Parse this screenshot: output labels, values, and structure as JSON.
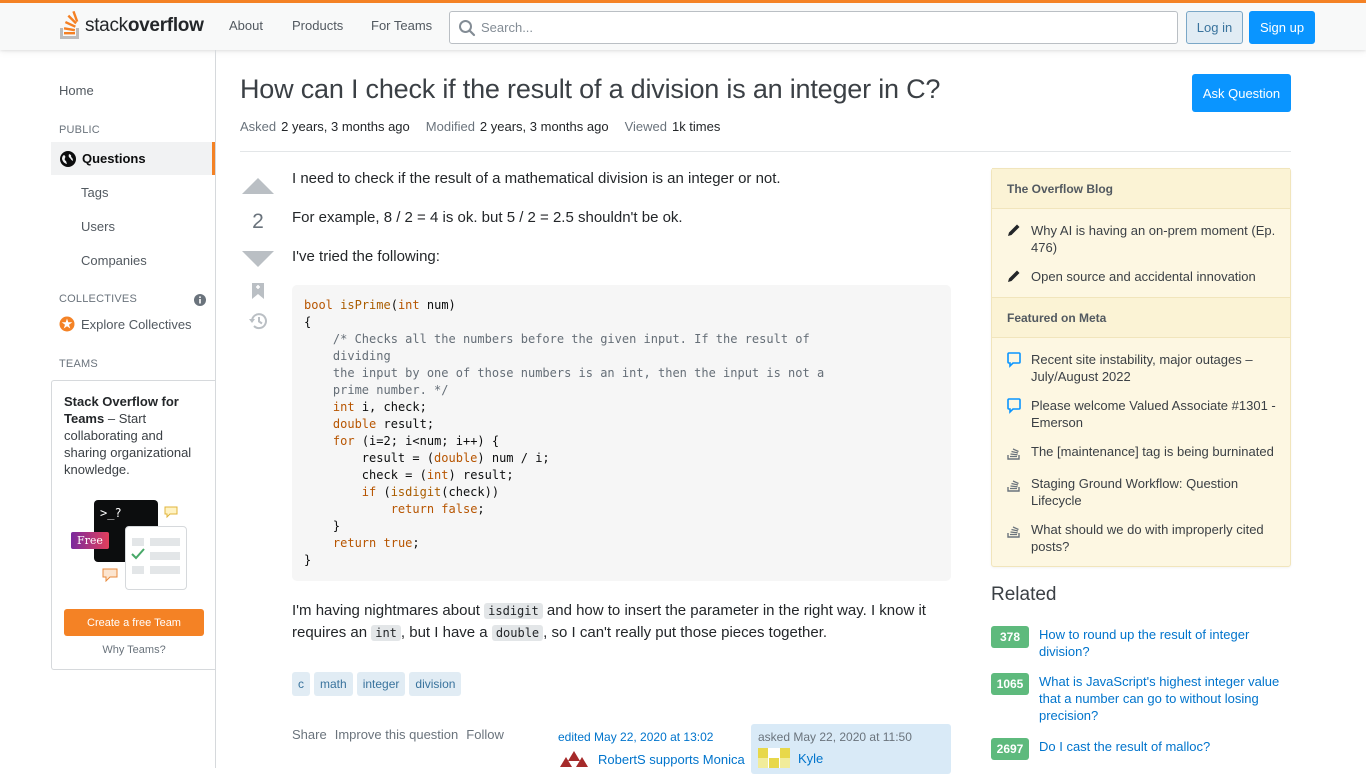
{
  "header": {
    "logo_light": "stack",
    "logo_bold": "overflow",
    "nav": [
      "About",
      "Products",
      "For Teams"
    ],
    "search_placeholder": "Search...",
    "login_label": "Log in",
    "signup_label": "Sign up",
    "accent_color": "#f48225"
  },
  "leftnav": {
    "home": "Home",
    "section_public": "PUBLIC",
    "questions": "Questions",
    "tags": "Tags",
    "users": "Users",
    "companies": "Companies",
    "section_collectives": "COLLECTIVES",
    "explore_collectives": "Explore Collectives",
    "section_teams": "TEAMS",
    "teams_bold": "Stack Overflow for Teams",
    "teams_text": " – Start collaborating and sharing organizational knowledge.",
    "illus_badge": "Free",
    "illus_prompt": ">_?",
    "create_team": "Create a free Team",
    "why_teams": "Why Teams?"
  },
  "question": {
    "title": "How can I check if the result of a division is an integer in C?",
    "asked_label": "Asked",
    "asked_value": "2 years, 3 months ago",
    "modified_label": "Modified",
    "modified_value": "2 years, 3 months ago",
    "viewed_label": "Viewed",
    "viewed_value": "1k times",
    "ask_button": "Ask Question",
    "votes": "2",
    "p1": "I need to check if the result of a mathematical division is an integer or not.",
    "p2": "For example, 8 / 2 = 4 is ok. but 5 / 2 = 2.5 shouldn't be ok.",
    "p3": "I've tried the following:",
    "p4_a": "I'm having nightmares about ",
    "p4_code1": "isdigit",
    "p4_b": " and how to insert the parameter in the right way. I know it requires an ",
    "p4_code2": "int",
    "p4_c": ", but I have a ",
    "p4_code3": "double",
    "p4_d": ", so I can't really put those pieces together.",
    "tags": [
      "c",
      "math",
      "integer",
      "division"
    ],
    "menu": [
      "Share",
      "Improve this question",
      "Follow"
    ],
    "edited_text": "edited May 22, 2020 at 13:02",
    "editor": "RobertS supports Monica",
    "asked_text": "asked May 22, 2020 at 11:50",
    "asker": "Kyle"
  },
  "code": {
    "l1_kw": "bool",
    "l1_fn": "isPrime",
    "l1_a": "(",
    "l1_kw2": "int",
    "l1_b": " num)",
    "l2": "{",
    "l3": "    /* Checks all the numbers before the given input. If the result of",
    "l4": "    dividing",
    "l5": "    the input by one of those numbers is an int, then the input is not a",
    "l6": "    prime number. */",
    "l7_kw": "int",
    "l7": " i, check;",
    "l8_kw": "double",
    "l8": " result;",
    "l9_kw": "for",
    "l9": " (i=2; i<num; i++) {",
    "l10_a": "        result = (",
    "l10_kw": "double",
    "l10_b": ") num / i;",
    "l11_a": "        check = (",
    "l11_kw": "int",
    "l11_b": ") result;",
    "l12_kw": "if",
    "l12_a": " (",
    "l12_fn": "isdigit",
    "l12_b": "(check))",
    "l13_kw": "return",
    "l13_kw2": "false",
    "l13_b": ";",
    "l14": "    }",
    "l15_kw": "return",
    "l15_kw2": "true",
    "l15_b": ";",
    "l16": "}"
  },
  "sidebar": {
    "blog_header": "The Overflow Blog",
    "blog_items": [
      "Why AI is having an on-prem moment (Ep. 476)",
      "Open source and accidental innovation"
    ],
    "meta_header": "Featured on Meta",
    "meta_items": [
      "Recent site instability, major outages – July/August 2022",
      "Please welcome Valued Associate #1301 - Emerson",
      "The [maintenance] tag is being burninated",
      "Staging Ground Workflow: Question Lifecycle",
      "What should we do with improperly cited posts?"
    ],
    "related_title": "Related",
    "related": [
      {
        "score": "378",
        "title": "How to round up the result of integer division?"
      },
      {
        "score": "1065",
        "title": "What is JavaScript's highest integer value that a number can go to without losing precision?"
      },
      {
        "score": "2697",
        "title": "Do I cast the result of malloc?"
      }
    ]
  }
}
